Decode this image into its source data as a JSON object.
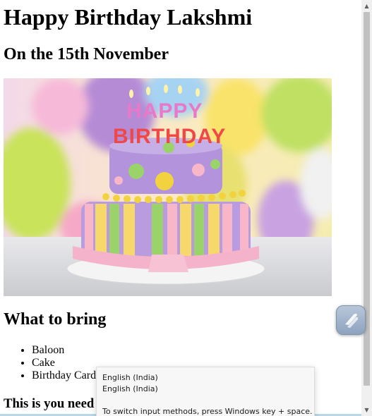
{
  "page": {
    "title": "Happy Birthday Lakshmi",
    "date_line": "On the 15th November",
    "image": {
      "alt": "Birthday cake with HAPPY BIRTHDAY candles",
      "candle_text_1": "HAPPY",
      "candle_text_2": "BIRTHDAY"
    },
    "bring_heading": "What to bring",
    "bring_items": [
      "Baloon",
      "Cake",
      "Birthday Card"
    ],
    "need_heading": "This is you need"
  },
  "ime_tooltip": {
    "language_1": "English (India)",
    "language_2": "English (India)",
    "hint": "To switch input methods, press Windows key + space."
  },
  "icons": {
    "floating_button": "pen-assistant-icon",
    "scroll_up": "scroll-up-arrow-icon",
    "scroll_down": "scroll-down-arrow-icon"
  },
  "colors": {
    "text": "#000000",
    "background": "#ffffff",
    "scroll_thumb": "#c1c1c1",
    "tooltip_bg": "#f7f7f7"
  }
}
